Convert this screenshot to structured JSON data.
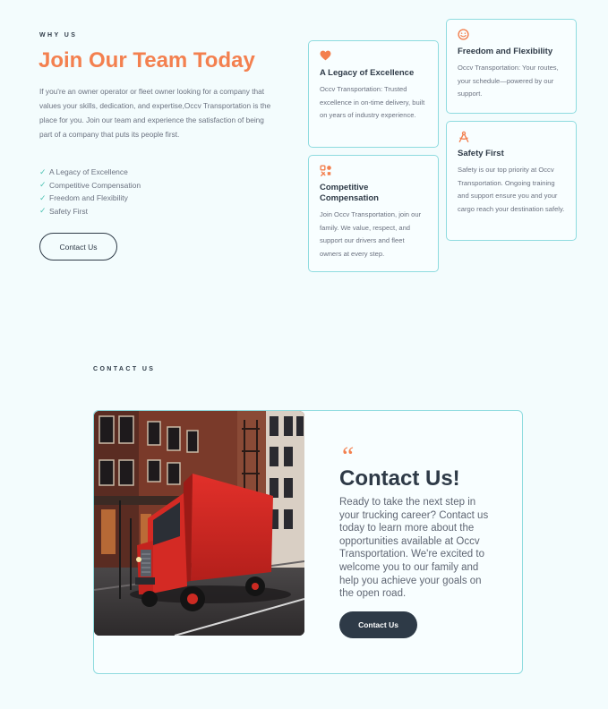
{
  "why_us": {
    "eyebrow": "WHY US",
    "title": "Join Our Team Today",
    "description": "If you're an owner operator or fleet owner looking for a company that values your skills, dedication, and expertise,Occv Transportation is the place for you. Join our team and experience the satisfaction of being part of a company that puts its people first.",
    "checklist": [
      "A Legacy of Excellence",
      "Competitive Compensation",
      "Freedom and Flexibility",
      "Safety First"
    ],
    "button_label": "Contact Us"
  },
  "cards": [
    {
      "icon": "heart-icon",
      "title": "A Legacy of Excellence",
      "text": "Occv Transportation: Trusted excellence in on-time delivery, built on years of industry experience."
    },
    {
      "icon": "tools-icon",
      "title": "Competitive Compensation",
      "text": "Join Occv Transportation, join our family. We value, respect, and support our drivers and fleet owners at every step."
    },
    {
      "icon": "smile-icon",
      "title": "Freedom and Flexibility",
      "text": "Occv Transportation: Your routes, your schedule—powered by our support."
    },
    {
      "icon": "compass-icon",
      "title": "Safety First",
      "text": "Safety is our top priority at Occv Transportation. Ongoing training and support ensure you and your cargo reach your destination safely."
    }
  ],
  "contact": {
    "eyebrow": "CONTACT US",
    "quote_mark": "“",
    "title": "Contact Us!",
    "text": "Ready to take the next step in your trucking career? Contact us today to learn more about the opportunities available at Occv Transportation. We're excited to welcome you to our family and help you achieve your goals on the open road.",
    "button_label": "Contact Us",
    "image_subject": "red-truck-city-street"
  },
  "colors": {
    "accent": "#f3804f",
    "dark": "#2e3a47",
    "border": "#8edbdf",
    "check": "#4fc3b4",
    "background": "#f3fcfd"
  }
}
